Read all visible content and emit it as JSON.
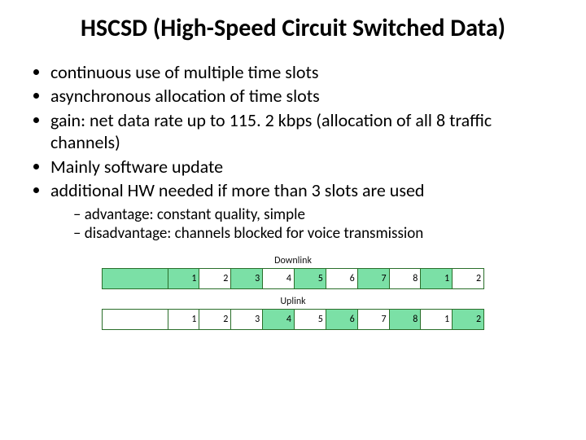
{
  "title": "HSCSD (High-Speed Circuit Switched Data)",
  "bullets": {
    "b1": "continuous use of multiple time slots",
    "b2": "asynchronous allocation of time slots",
    "b3": "gain: net data rate up to 115. 2 kbps (allocation of all 8 traffic channels)",
    "b4": "Mainly software update",
    "b5": "additional HW needed if more than 3 slots are used",
    "s1": "advantage: constant quality, simple",
    "s2": "disadvantage: channels blocked for voice transmission"
  },
  "diagram": {
    "downlink_label": "Downlink",
    "uplink_label": "Uplink",
    "downlink_cells": [
      {
        "label": "",
        "green": true,
        "wide": true
      },
      {
        "label": "1",
        "green": true
      },
      {
        "label": "2",
        "green": false
      },
      {
        "label": "3",
        "green": true
      },
      {
        "label": "4",
        "green": false
      },
      {
        "label": "5",
        "green": true
      },
      {
        "label": "6",
        "green": false
      },
      {
        "label": "7",
        "green": true
      },
      {
        "label": "8",
        "green": false
      },
      {
        "label": "1",
        "green": true
      },
      {
        "label": "2",
        "green": false
      }
    ],
    "uplink_cells": [
      {
        "label": "",
        "green": false,
        "wide": true
      },
      {
        "label": "1",
        "green": false
      },
      {
        "label": "2",
        "green": false
      },
      {
        "label": "3",
        "green": false
      },
      {
        "label": "4",
        "green": true
      },
      {
        "label": "5",
        "green": false
      },
      {
        "label": "6",
        "green": true
      },
      {
        "label": "7",
        "green": false
      },
      {
        "label": "8",
        "green": true
      },
      {
        "label": "1",
        "green": false
      },
      {
        "label": "2",
        "green": true
      }
    ]
  }
}
